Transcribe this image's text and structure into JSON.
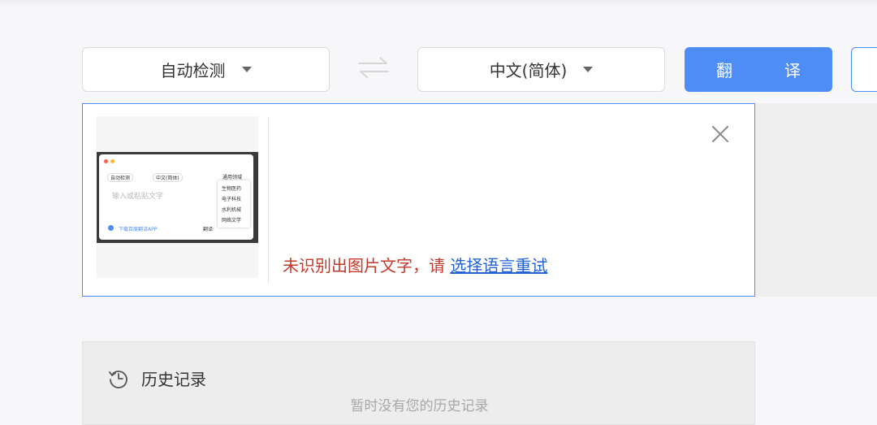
{
  "toolbar": {
    "source_language": "自动检测",
    "target_language": "中文(简体)",
    "translate_label": "翻　译"
  },
  "source_panel": {
    "error_text": "未识别出图片文字，请 ",
    "retry_link": "选择语言重试"
  },
  "thumbnail": {
    "source_language": "自动检测",
    "target_language": "中文(简体)",
    "domain_label": "通用领域",
    "placeholder": "输入或粘贴文字",
    "domain_options": [
      "生物医药",
      "电子科技",
      "水利机械",
      "网络文学"
    ],
    "download_text": "下载百度翻译APP",
    "translate_text": "翻译"
  },
  "history": {
    "title": "历史记录",
    "empty_text": "暂时没有您的历史记录"
  },
  "colors": {
    "accent": "#4e8df5",
    "error": "#c0392b",
    "link": "#2262d4"
  },
  "icons": [
    "caret-down-icon",
    "swap-arrows-icon",
    "close-icon",
    "history-clock-icon"
  ]
}
